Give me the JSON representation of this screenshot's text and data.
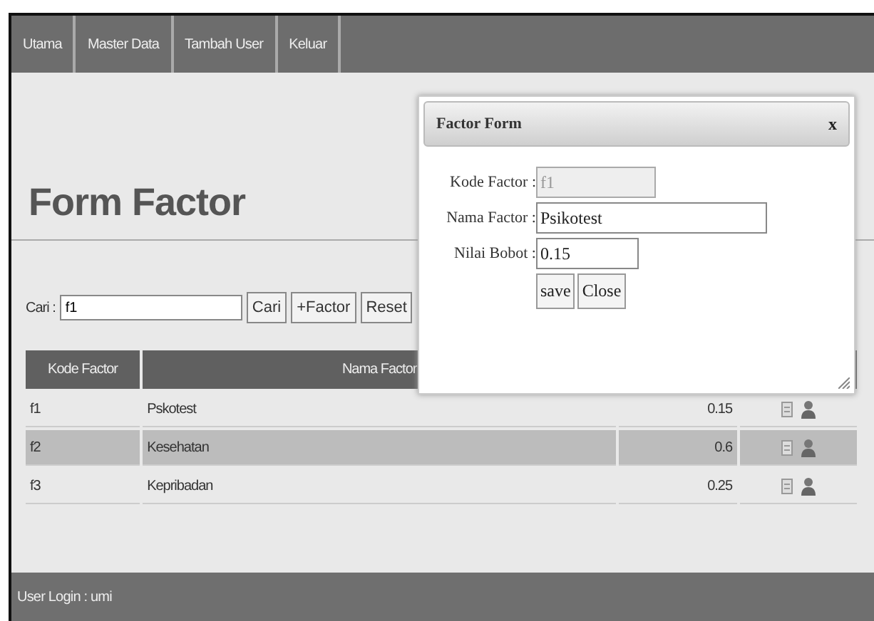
{
  "nav": [
    {
      "label": "Utama"
    },
    {
      "label": "Master Data"
    },
    {
      "label": "Tambah User"
    },
    {
      "label": "Keluar"
    }
  ],
  "page_title": "Form Factor",
  "search": {
    "label": "Cari :",
    "value": "f1",
    "buttons": [
      "Cari",
      "+Factor",
      "Reset"
    ]
  },
  "table": {
    "columns": [
      "Kode Factor",
      "Nama Factor"
    ],
    "rows": [
      {
        "kode": "f1",
        "nama": "Pskotest",
        "bobot": "0.15",
        "selected": false
      },
      {
        "kode": "f2",
        "nama": "Kesehatan",
        "bobot": "0.6",
        "selected": true
      },
      {
        "kode": "f3",
        "nama": "Kepribadan",
        "bobot": "0.25",
        "selected": false
      }
    ]
  },
  "dialog": {
    "title": "Factor Form",
    "close": "x",
    "fields": [
      {
        "label": "Kode Factor :",
        "value": "f1",
        "disabled": true
      },
      {
        "label": "Nama Factor :",
        "value": "Psikotest",
        "disabled": false
      },
      {
        "label": "Nilai Bobot :",
        "value": "0.15",
        "disabled": false
      }
    ],
    "buttons": [
      "save",
      "Close"
    ]
  },
  "status_bar": "User Login : umi"
}
